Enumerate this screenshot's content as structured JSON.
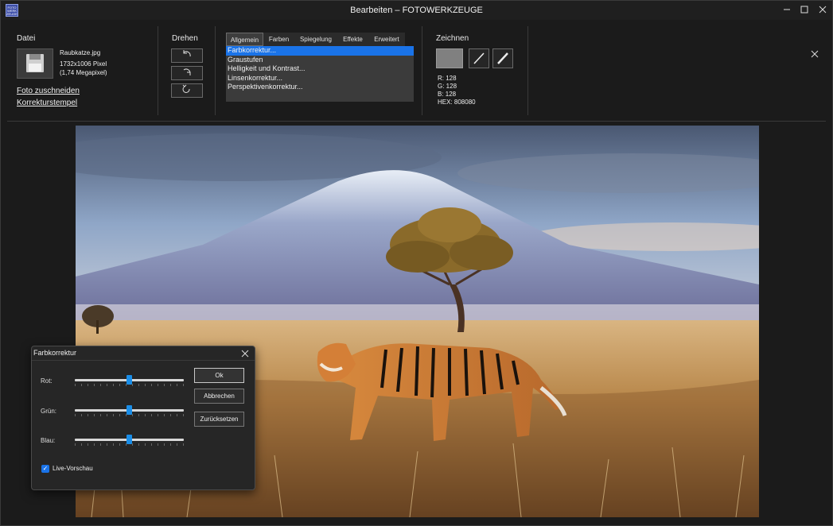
{
  "titlebar": {
    "app_icon_text": "FOTO WERK ZEUGE",
    "title": "Bearbeiten – FOTOWERKZEUGE",
    "minimize_icon": "minimize-icon",
    "maximize_icon": "maximize-icon",
    "close_icon": "close-icon"
  },
  "file_group": {
    "title": "Datei",
    "icon": "floppy-disk-icon",
    "file_name": "Raubkatze.jpg",
    "dimensions": "1732x1006 Pixel",
    "megapixels": "(1,74 Megapixel)",
    "crop_link": "Foto zuschneiden",
    "stamp_link": "Korrekturstempel"
  },
  "rotate_group": {
    "title": "Drehen",
    "buttons": [
      {
        "icon": "rotate-left-icon",
        "glyph": "⤺"
      },
      {
        "icon": "rotate-right-icon",
        "glyph": "⤻"
      },
      {
        "icon": "flip-icon",
        "glyph": "↺"
      }
    ]
  },
  "adjust_group": {
    "tabs": [
      "Allgemein",
      "Farben",
      "Spiegelung",
      "Effekte",
      "Erweitert"
    ],
    "active_tab": "Allgemein",
    "items": [
      "Farbkorrektur...",
      "Graustufen",
      "Helligkeit und Kontrast...",
      "Linsenkorrektur...",
      "Perspektivenkorrektur..."
    ],
    "selected_item": "Farbkorrektur..."
  },
  "draw_group": {
    "title": "Zeichnen",
    "color_hex": "#808080",
    "pen_icon": "pen-icon",
    "pencil_icon": "pencil-icon",
    "r": "R: 128",
    "g": "G: 128",
    "b": "B: 128",
    "hex": "HEX: 808080"
  },
  "ribbon_close_icon": "close-icon",
  "dialog": {
    "title": "Farbkorrektur",
    "sliders": [
      {
        "label": "Rot:",
        "value": 0.5
      },
      {
        "label": "Grün:",
        "value": 0.5
      },
      {
        "label": "Blau:",
        "value": 0.5
      }
    ],
    "ok": "Ok",
    "cancel": "Abbrechen",
    "reset": "Zurücksetzen",
    "live_preview": "Live-Vorschau",
    "live_preview_checked": true
  },
  "colors": {
    "accent": "#1a73e8",
    "slider_thumb": "#1a8ee8"
  }
}
